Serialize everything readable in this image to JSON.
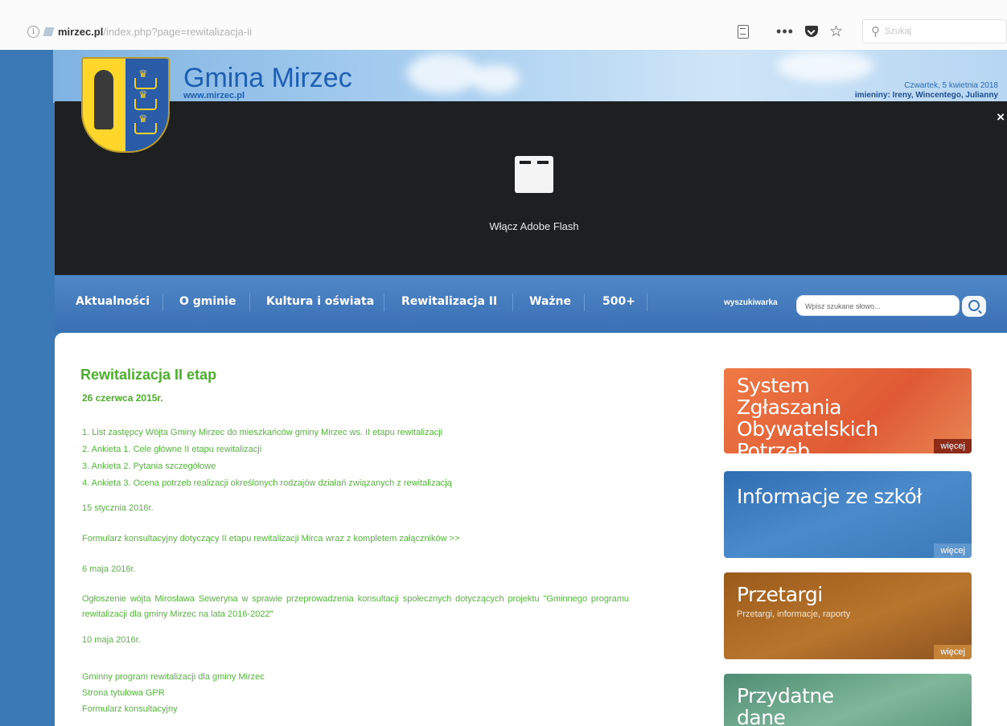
{
  "browser": {
    "url_domain": "mirzec.pl",
    "url_path": "/index.php?page=rewitalizacja-ii",
    "search_placeholder": "Szukaj"
  },
  "header": {
    "site_title": "Gmina Mirzec",
    "site_url": "www.mirzec.pl",
    "date": "Czwartek, 5 kwietnia 2018",
    "names": "imieniny: Ireny, Wincentego, Julianny"
  },
  "flash": {
    "label": "Włącz Adobe Flash",
    "close": "×"
  },
  "nav": {
    "items": [
      "Aktualności",
      "O gminie",
      "Kultura i oświata",
      "Rewitalizacja II",
      "Ważne",
      "500+"
    ],
    "search_label": "wyszukiwarka",
    "search_placeholder": "Wpisz szukane słowo..."
  },
  "main": {
    "heading": "Rewitalizacja II etap",
    "date1": "26 czerwca 2015r.",
    "list": [
      "1. List zastępcy Wójta Gminy Mirzec do mieszkańców gminy Mirzec ws. II etapu rewitalizacji",
      "2. Ankieta 1. Cele główne II etapu rewitalizacji",
      "3. Ankieta 2. Pytania szczegółowe",
      "4. Ankieta 3. Ocena potrzeb realizacji określonych rodzajów działań związanych z rewitalizacją"
    ],
    "date2": "15 stycznia 2016r.",
    "form_text": "Formularz konsultacyjny dotyczący II etapu rewitalizacji Mirca wraz z kompletem załączników >>",
    "date3": "6 maja 2016r.",
    "announcement": "Ogłoszenie wójta Mirosława Seweryna w sprawie przeprowadzenia konsultacji społecznych dotyczących projektu \"Gminnego programu rewitalizacji dla gminy Mirzec na lata 2016-2022\"",
    "date4": "10 maja 2016r.",
    "links": [
      "Gminny program rewitalizacji dla gminy Mirzec",
      "Strona tytułowa GPR",
      "Formularz konsultacyjny"
    ]
  },
  "sidebar": {
    "tile1": {
      "title": "System Zgłaszania Obywatelskich Potrzeb",
      "more": "więcej"
    },
    "tile2": {
      "title": "Informacje ze szkół",
      "more": "więcej"
    },
    "tile3": {
      "title": "Przetargi",
      "subtitle": "Przetargi, informacje, raporty",
      "more": "więcej"
    },
    "tile4": {
      "title": "Przydatne dane teleadresowe"
    }
  },
  "colors": {
    "nav": "#3a70b4",
    "heading_green": "#4caf2c",
    "tile_orange": "#e5643a",
    "tile_blue": "#3c7bbf",
    "tile_brown": "#a5651f",
    "tile_green": "#5c9b7e"
  }
}
